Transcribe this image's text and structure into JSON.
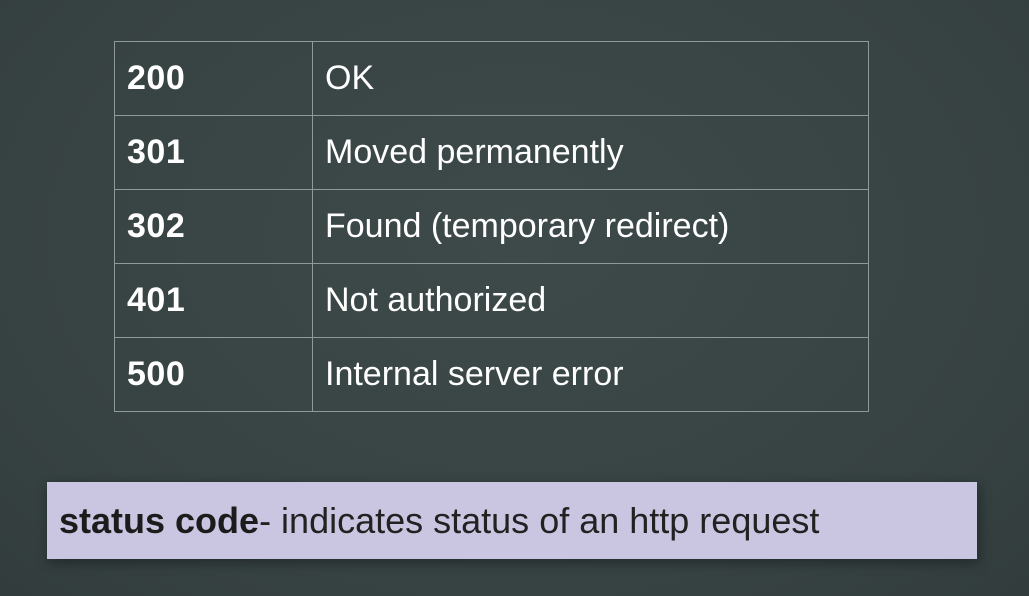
{
  "table": {
    "rows": [
      {
        "code": "200",
        "description": "OK"
      },
      {
        "code": "301",
        "description": "Moved permanently"
      },
      {
        "code": "302",
        "description": "Found (temporary redirect)"
      },
      {
        "code": "401",
        "description": "Not authorized"
      },
      {
        "code": "500",
        "description": "Internal server error"
      }
    ]
  },
  "caption": {
    "term": "status code",
    "definition": " - indicates status of an http request"
  },
  "colors": {
    "background": "#3a4545",
    "table_border": "#8d9a99",
    "caption_background": "#cac6e1"
  }
}
